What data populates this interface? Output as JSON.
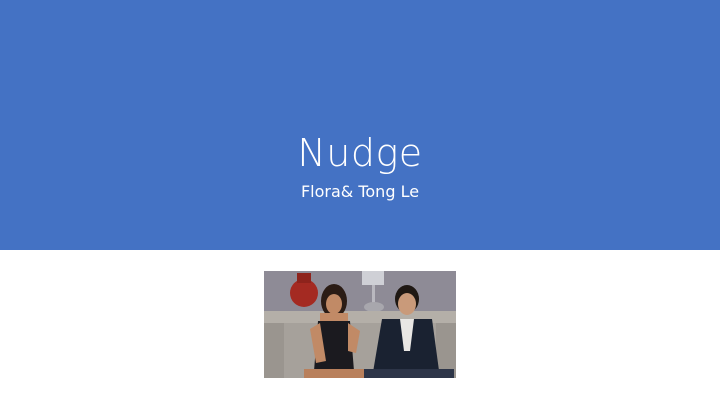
{
  "slide": {
    "title": "Nudge",
    "subtitle": "Flora& Tong Le",
    "colors": {
      "band": "#4472c4",
      "background": "#ffffff",
      "text": "#ffffff"
    }
  }
}
